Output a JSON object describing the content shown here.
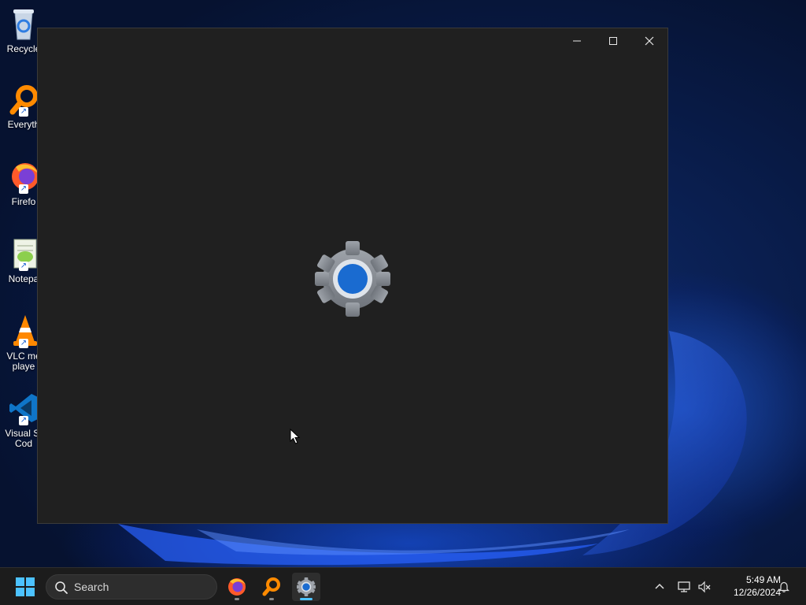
{
  "desktop": {
    "icons": [
      {
        "label": "Recycle",
        "icon": "recycle-bin-icon"
      },
      {
        "label": "Everyth",
        "icon": "everything-search-icon"
      },
      {
        "label": "Firefo",
        "icon": "firefox-icon"
      },
      {
        "label": "Notepa",
        "icon": "notepad-plus-plus-icon"
      },
      {
        "label": "VLC me\nplaye",
        "icon": "vlc-icon"
      },
      {
        "label": "Visual St\nCod",
        "icon": "vscode-icon"
      }
    ]
  },
  "window": {
    "controls": {
      "minimize": "—",
      "maximize": "☐",
      "close": "✕"
    },
    "splash_icon": "settings-gear-icon",
    "colors": {
      "background": "#202020",
      "gear": "#8f949b",
      "gear_center": "#1a6bd0"
    }
  },
  "taskbar": {
    "start_icon": "windows-start-icon",
    "search": {
      "placeholder": "Search"
    },
    "apps": [
      {
        "name": "Firefox",
        "icon": "firefox-icon",
        "active": false
      },
      {
        "name": "Everything",
        "icon": "everything-search-icon",
        "active": false
      },
      {
        "name": "Settings",
        "icon": "settings-gear-icon",
        "active": true
      }
    ],
    "tray": {
      "icons": [
        "chevron-up-icon",
        "network-icon",
        "volume-muted-icon"
      ],
      "time": "5:49 AM",
      "date": "12/26/2024",
      "notification_icon": "bell-icon"
    }
  }
}
